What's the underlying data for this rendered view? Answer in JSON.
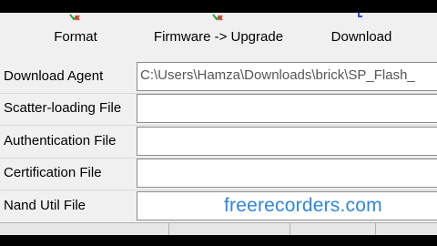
{
  "toolbar": {
    "format_label": "Format",
    "firmware_upgrade_label": "Firmware -> Upgrade",
    "download_label": "Download"
  },
  "fields": {
    "download_agent": {
      "label": "Download Agent",
      "value": "C:\\Users\\Hamza\\Downloads\\brick\\SP_Flash_"
    },
    "scatter_loading": {
      "label": "Scatter-loading File",
      "value": ""
    },
    "authentication": {
      "label": "Authentication File",
      "value": ""
    },
    "certification": {
      "label": "Certification File",
      "value": ""
    },
    "nand_util": {
      "label": "Nand Util File",
      "value": ""
    }
  },
  "watermark": "freerecorders.com",
  "colors": {
    "watermark": "#2e86de",
    "toolbar_bg": "#f0f0f0",
    "icon_green": "#2e9e3a",
    "icon_red": "#d63a2a"
  }
}
